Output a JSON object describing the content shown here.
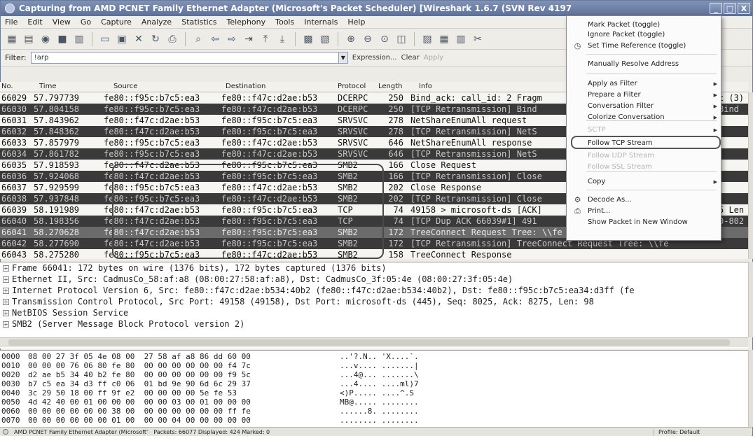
{
  "window": {
    "title": "Capturing from AMD PCNET Family Ethernet Adapter (Microsoft's Packet Scheduler)   [Wireshark 1.6.7  (SVN Rev 4197",
    "controls": {
      "minimize": "_",
      "maximize": "□",
      "close": "X"
    }
  },
  "menubar": [
    "File",
    "Edit",
    "View",
    "Go",
    "Capture",
    "Analyze",
    "Statistics",
    "Telephony",
    "Tools",
    "Internals",
    "Help"
  ],
  "filter": {
    "label": "Filter:",
    "value": "!arp",
    "expression": "Expression...",
    "clear": "Clear",
    "apply": "Apply"
  },
  "columns": [
    "No.",
    "Time",
    "Source",
    "Destination",
    "Protocol",
    "Length",
    "Info"
  ],
  "packets": [
    {
      "no": "66029",
      "time": "57.797739",
      "src": "fe80::f95c:b7c5:ea3",
      "dst": "fe80::f47c:d2ae:b53",
      "proto": "DCERPC",
      "len": "250",
      "info": "Bind_ack: call_id: 2 Fragm",
      "style": "normal"
    },
    {
      "no": "66030",
      "time": "57.804158",
      "src": "fe80::f95c:b7c5:ea3",
      "dst": "fe80::f47c:d2ae:b53",
      "proto": "DCERPC",
      "len": "250",
      "info": "[TCP Retransmission] Bind",
      "style": "dark"
    },
    {
      "no": "66031",
      "time": "57.843962",
      "src": "fe80::f47c:d2ae:b53",
      "dst": "fe80::f95c:b7c5:ea3",
      "proto": "SRVSVC",
      "len": "278",
      "info": "NetShareEnumAll request",
      "style": "normal"
    },
    {
      "no": "66032",
      "time": "57.848362",
      "src": "fe80::f47c:d2ae:b53",
      "dst": "fe80::f95c:b7c5:ea3",
      "proto": "SRVSVC",
      "len": "278",
      "info": "[TCP Retransmission] NetS",
      "style": "dark"
    },
    {
      "no": "66033",
      "time": "57.857979",
      "src": "fe80::f95c:b7c5:ea3",
      "dst": "fe80::f47c:d2ae:b53",
      "proto": "SRVSVC",
      "len": "646",
      "info": "NetShareEnumAll response",
      "style": "normal"
    },
    {
      "no": "66034",
      "time": "57.861782",
      "src": "fe80::f95c:b7c5:ea3",
      "dst": "fe80::f47c:d2ae:b53",
      "proto": "SRVSVC",
      "len": "646",
      "info": "[TCP Retransmission] NetS",
      "style": "dark"
    },
    {
      "no": "66035",
      "time": "57.918593",
      "src": "fe80::f47c:d2ae:b53",
      "dst": "fe80::f95c:b7c5:ea3",
      "proto": "SMB2",
      "len": "166",
      "info": "Close Request",
      "style": "normal"
    },
    {
      "no": "66036",
      "time": "57.924068",
      "src": "fe80::f47c:d2ae:b53",
      "dst": "fe80::f95c:b7c5:ea3",
      "proto": "SMB2",
      "len": "166",
      "info": "[TCP Retransmission] Close",
      "style": "dark"
    },
    {
      "no": "66037",
      "time": "57.929599",
      "src": "fe80::f95c:b7c5:ea3",
      "dst": "fe80::f47c:d2ae:b53",
      "proto": "SMB2",
      "len": "202",
      "info": "Close Response",
      "style": "normal"
    },
    {
      "no": "66038",
      "time": "57.937848",
      "src": "fe80::f95c:b7c5:ea3",
      "dst": "fe80::f47c:d2ae:b53",
      "proto": "SMB2",
      "len": "202",
      "info": "[TCP Retransmission] Close",
      "style": "dark"
    },
    {
      "no": "66039",
      "time": "58.191989",
      "src": "fe80::f47c:d2ae:b53",
      "dst": "fe80::f95c:b7c5:ea3",
      "proto": "TCP",
      "len": "74",
      "info": "49158 > microsoft-ds [ACK]",
      "style": "normal"
    },
    {
      "no": "66040",
      "time": "58.198356",
      "src": "fe80::f47c:d2ae:b53",
      "dst": "fe80::f95c:b7c5:ea3",
      "proto": "TCP",
      "len": "74",
      "info": "[TCP Dup ACK 66039#1] 491",
      "style": "dark"
    },
    {
      "no": "66041",
      "time": "58.270628",
      "src": "fe80::f47c:d2ae:b53",
      "dst": "fe80::f95c:b7c5:ea3",
      "proto": "SMB2",
      "len": "172",
      "info": "TreeConnect Request Tree: \\\\fe",
      "style": "selected"
    },
    {
      "no": "66042",
      "time": "58.277690",
      "src": "fe80::f47c:d2ae:b53",
      "dst": "fe80::f95c:b7c5:ea3",
      "proto": "SMB2",
      "len": "172",
      "info": "[TCP Retransmission] TreeConnect Request Tree: \\\\fe",
      "style": "dark"
    },
    {
      "no": "66043",
      "time": "58.275280",
      "src": "fe80::f95c:b7c5:ea3",
      "dst": "fe80::f47c:d2ae:b53",
      "proto": "SMB2",
      "len": "158",
      "info": "TreeConnect Response",
      "style": "normal"
    }
  ],
  "overflow_right": {
    "row0": "t (3)",
    "row1": "Bind",
    "row10": "5 Len",
    "row11": "0-802"
  },
  "details": [
    "Frame 66041: 172 bytes on wire (1376 bits), 172 bytes captured (1376 bits)",
    "Ethernet II, Src: CadmusCo_58:af:a8 (08:00:27:58:af:a8), Dst: CadmusCo_3f:05:4e (08:00:27:3f:05:4e)",
    "Internet Protocol Version 6, Src: fe80::f47c:d2ae:b534:40b2 (fe80::f47c:d2ae:b534:40b2), Dst: fe80::f95c:b7c5:ea34:d3ff (fe",
    "Transmission Control Protocol, Src Port: 49158 (49158), Dst Port: microsoft-ds (445), Seq: 8025, Ack: 8275, Len: 98",
    "NetBIOS Session Service",
    "SMB2 (Server Message Block Protocol version 2)"
  ],
  "bytes": [
    {
      "off": "0000",
      "hex": "08 00 27 3f 05 4e 08 00  27 58 af a8 86 dd 60 00",
      "ascii": "..'?.N.. 'X....`."
    },
    {
      "off": "0010",
      "hex": "00 00 00 76 06 80 fe 80  00 00 00 00 00 00 f4 7c",
      "ascii": "...v.... .......|"
    },
    {
      "off": "0020",
      "hex": "d2 ae b5 34 40 b2 fe 80  00 00 00 00 00 00 f9 5c",
      "ascii": "...4@... .......\\"
    },
    {
      "off": "0030",
      "hex": "b7 c5 ea 34 d3 ff c0 06  01 bd 9e 90 6d 6c 29 37",
      "ascii": "...4.... ....ml)7"
    },
    {
      "off": "0040",
      "hex": "3c 29 50 18 00 ff 9f e2  00 00 00 00 5e fe 53",
      "ascii": "<)P..... ....^.S"
    },
    {
      "off": "0050",
      "hex": "4d 42 40 00 01 00 00 00  00 00 03 00 01 00 00 00",
      "ascii": "MB@..... ........"
    },
    {
      "off": "0060",
      "hex": "00 00 00 00 00 00 38 00  00 00 00 00 00 00 ff fe",
      "ascii": "......8. ........"
    },
    {
      "off": "0070",
      "hex": "00 00 00 00 00 00 01 00  00 00 04 00 00 00 00 00",
      "ascii": "........ ........"
    }
  ],
  "statusbar": {
    "adapter": "AMD PCNET Family Ethernet Adapter (Microsoft'",
    "counts": "Packets: 66077 Displayed: 424 Marked: 0",
    "profile": "Profile: Default"
  },
  "context_menu": {
    "items": [
      {
        "label": "Mark Packet (toggle)",
        "icon": "",
        "submenu": false,
        "enabled": true
      },
      {
        "label": "Ignore Packet (toggle)",
        "icon": "",
        "submenu": false,
        "enabled": true
      },
      {
        "label": "Set Time Reference (toggle)",
        "icon": "clock-icon",
        "submenu": false,
        "enabled": true
      },
      {
        "label": "Manually Resolve Address",
        "icon": "",
        "submenu": false,
        "enabled": true
      },
      {
        "label": "Apply as Filter",
        "icon": "",
        "submenu": true,
        "enabled": true
      },
      {
        "label": "Prepare a Filter",
        "icon": "",
        "submenu": true,
        "enabled": true
      },
      {
        "label": "Conversation Filter",
        "icon": "",
        "submenu": true,
        "enabled": true
      },
      {
        "label": "Colorize Conversation",
        "icon": "",
        "submenu": true,
        "enabled": true
      },
      {
        "label": "SCTP",
        "icon": "",
        "submenu": true,
        "enabled": false
      },
      {
        "label": "Follow TCP Stream",
        "icon": "",
        "submenu": false,
        "enabled": true
      },
      {
        "label": "Follow UDP Stream",
        "icon": "",
        "submenu": false,
        "enabled": false
      },
      {
        "label": "Follow SSL Stream",
        "icon": "",
        "submenu": false,
        "enabled": false
      },
      {
        "label": "Copy",
        "icon": "",
        "submenu": true,
        "enabled": true
      },
      {
        "label": "Decode As...",
        "icon": "decode-icon",
        "submenu": false,
        "enabled": true
      },
      {
        "label": "Print...",
        "icon": "printer-icon",
        "submenu": false,
        "enabled": true
      },
      {
        "label": "Show Packet in New Window",
        "icon": "",
        "submenu": false,
        "enabled": true
      }
    ]
  },
  "colors": {
    "row_normal": "#f6f5f1",
    "row_dark": "#3a3a3a",
    "row_selected": "#6b6b6b",
    "titlebar": "#6a7ca3"
  }
}
